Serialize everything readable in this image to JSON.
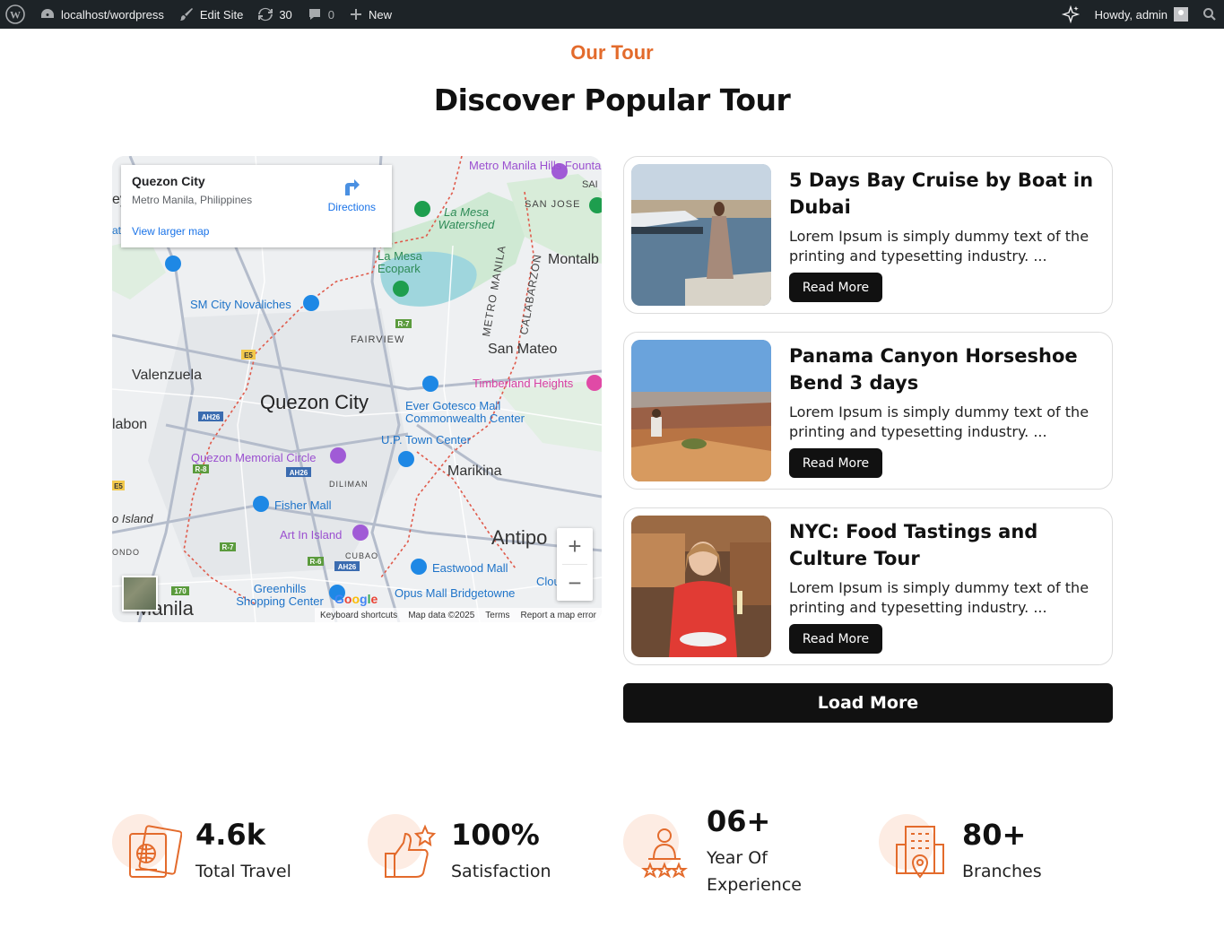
{
  "adminbar": {
    "site": "localhost/wordpress",
    "edit_site": "Edit Site",
    "updates": "30",
    "comments": "0",
    "new": "New",
    "howdy": "Howdy, admin"
  },
  "section": {
    "kicker": "Our Tour",
    "title": "Discover Popular Tour"
  },
  "map": {
    "place": "Quezon City",
    "address": "Metro Manila, Philippines",
    "directions": "Directions",
    "view_larger": "View larger map",
    "zoom_in": "+",
    "zoom_out": "−",
    "attribution": {
      "shortcuts": "Keyboard shortcuts",
      "data": "Map data ©2025",
      "terms": "Terms",
      "report": "Report a map error"
    },
    "google": "Google",
    "labels": {
      "metro_manila_hills": "Metro Manila Hills Fountain",
      "la_mesa_watershed": "La Mesa Watershed",
      "san_jose": "SAN JOSE",
      "montalban": "Montalb",
      "la_mesa_ecopark": "La Mesa Ecopark",
      "sm_novaliches": "SM City Novaliches",
      "metro_manila_road": "METRO MANILA",
      "calabarzon": "CALABARZON",
      "fairview": "FAIRVIEW",
      "san_mateo": "San Mateo",
      "valenzuela": "Valenzuela",
      "timberland": "Timberland Heights",
      "quezon_city": "Quezon City",
      "ever_gotesco": "Ever Gotesco Mall Commonwealth Center",
      "malabon": "labon",
      "up_town": "U.P. Town Center",
      "qc_circle": "Quezon Memorial Circle",
      "marikina": "Marikina",
      "diliman": "DILIMAN",
      "fisher_mall": "Fisher Mall",
      "island": "o Island",
      "art_in_island": "Art In Island",
      "antipolo": "Antipo",
      "cubao": "CUBAO",
      "eastwood": "Eastwood Mall",
      "greenhills": "Greenhills Shopping Center",
      "opus_mall": "Opus Mall Bridgetowne",
      "manila": "Manila",
      "ondo": "ONDO",
      "cloud": "Clou",
      "sai": "SAI",
      "ey": "ey",
      "at": "at"
    }
  },
  "tours": [
    {
      "title": "5 Days Bay Cruise by Boat in Dubai",
      "description": "Lorem Ipsum is simply dummy text of the printing and typesetting industry. ...",
      "button": "Read More"
    },
    {
      "title": "Panama Canyon Horseshoe Bend 3 days",
      "description": "Lorem Ipsum is simply dummy text of the printing and typesetting industry. ...",
      "button": "Read More"
    },
    {
      "title": "NYC: Food Tastings and Culture Tour",
      "description": "Lorem Ipsum is simply dummy text of the printing and typesetting industry. ...",
      "button": "Read More"
    }
  ],
  "load_more": "Load More",
  "stats": [
    {
      "value": "4.6k",
      "label": "Total Travel",
      "icon": "passport-icon"
    },
    {
      "value": "100%",
      "label": "Satisfaction",
      "icon": "thumbs-up-icon"
    },
    {
      "value": "06+",
      "label": "Year Of Experience",
      "icon": "experience-icon"
    },
    {
      "value": "80+",
      "label": "Branches",
      "icon": "building-icon"
    }
  ],
  "colors": {
    "accent": "#e36b2c",
    "adminbar": "#1d2327",
    "button": "#111111"
  }
}
